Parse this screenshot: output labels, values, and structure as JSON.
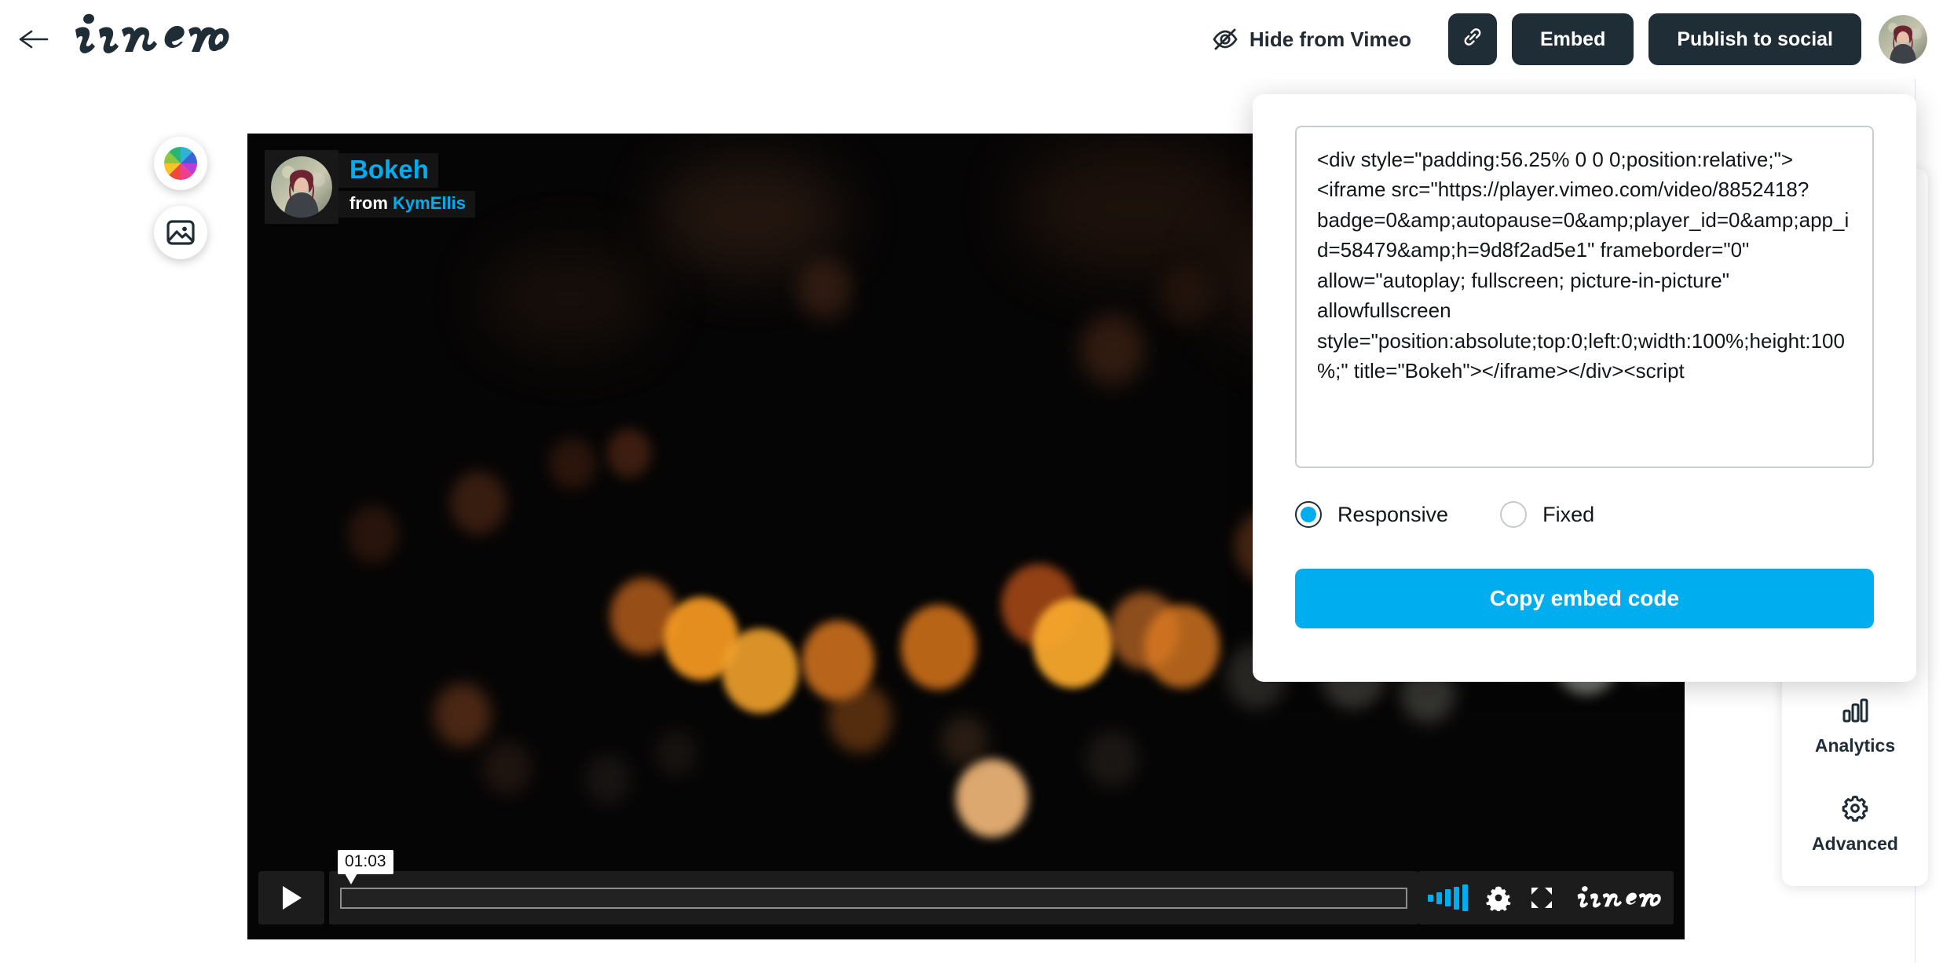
{
  "header": {
    "back_icon": "arrow-left-icon",
    "logo_text": "vimeo",
    "hide_from_vimeo_label": "Hide from Vimeo",
    "hide_icon": "eye-off-icon",
    "link_icon": "link-icon",
    "embed_label": "Embed",
    "publish_label": "Publish to social",
    "avatar": "user-avatar"
  },
  "tools": [
    {
      "name": "color-wheel-icon",
      "label": "Color"
    },
    {
      "name": "thumbnail-image-icon",
      "label": "Thumbnail"
    }
  ],
  "player": {
    "title": "Bokeh",
    "from_prefix": "from",
    "author": "KymEllis",
    "time_tooltip": "01:03",
    "play_icon": "play-icon",
    "volume_icon": "volume-bars-icon",
    "settings_icon": "gear-icon",
    "fullscreen_icon": "fullscreen-icon",
    "brand": "vimeo",
    "progress_percent": 0
  },
  "sidebar": {
    "items": [
      {
        "label": "Analytics",
        "icon": "chart-icon"
      },
      {
        "label": "Advanced",
        "icon": "gear-icon"
      }
    ]
  },
  "embed_panel": {
    "code": "<div style=\"padding:56.25% 0 0 0;position:relative;\"><iframe src=\"https://player.vimeo.com/video/8852418?badge=0&amp;autopause=0&amp;player_id=0&amp;app_id=58479&amp;h=9d8f2ad5e1\" frameborder=\"0\" allow=\"autoplay; fullscreen; picture-in-picture\" allowfullscreen style=\"position:absolute;top:0;left:0;width:100%;height:100%;\" title=\"Bokeh\"></iframe></div><script",
    "options": [
      {
        "label": "Responsive",
        "selected": true
      },
      {
        "label": "Fixed",
        "selected": false
      }
    ],
    "copy_label": "Copy embed code"
  },
  "colors": {
    "accent": "#00adef",
    "dark": "#1f2d37",
    "panel_bg": "#ffffff",
    "player_bg": "#000000"
  }
}
